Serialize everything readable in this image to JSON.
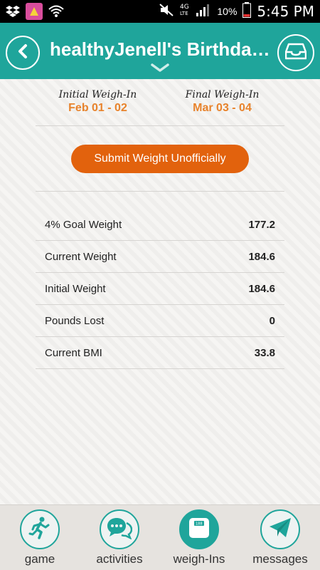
{
  "status_bar": {
    "battery_percent": "10%",
    "time": "5:45 PM",
    "icons": [
      "dropbox-icon",
      "app-notification-icon",
      "wifi-icon",
      "mute-icon",
      "4g-lte-icon",
      "signal-icon",
      "battery-icon"
    ]
  },
  "header": {
    "title": "healthyJenell's Birthda…",
    "color": "#1fa59b"
  },
  "weigh_ins": {
    "initial_label": "Initial Weigh-In",
    "initial_date": "Feb 01 - 02",
    "final_label": "Final Weigh-In",
    "final_date": "Mar 03 - 04",
    "date_color": "#e8832c"
  },
  "submit_button": {
    "label": "Submit Weight Unofficially",
    "color": "#e2620d"
  },
  "stats": [
    {
      "label": "4% Goal Weight",
      "value": "177.2"
    },
    {
      "label": "Current Weight",
      "value": "184.6"
    },
    {
      "label": "Initial Weight",
      "value": "184.6"
    },
    {
      "label": "Pounds Lost",
      "value": "0"
    },
    {
      "label": "Current BMI",
      "value": "33.8"
    }
  ],
  "bottom_nav": [
    {
      "label": "game",
      "icon": "runner-icon"
    },
    {
      "label": "activities",
      "icon": "chat-bubbles-icon"
    },
    {
      "label": "weigh-Ins",
      "icon": "scale-icon",
      "active": true
    },
    {
      "label": "messages",
      "icon": "paper-plane-icon"
    }
  ]
}
